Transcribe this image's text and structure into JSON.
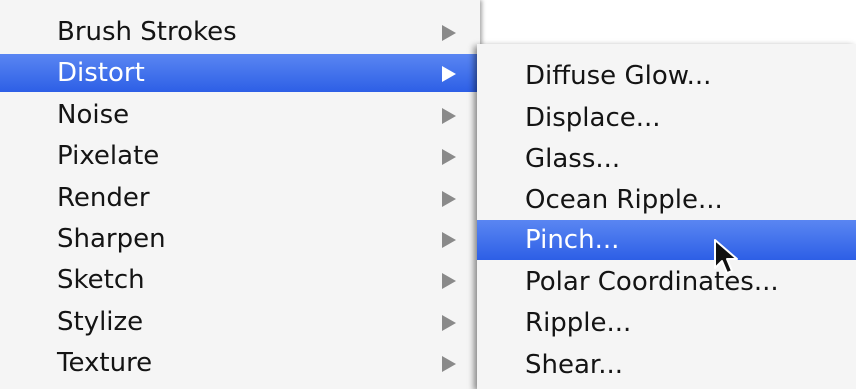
{
  "menu": {
    "items": [
      {
        "label": "Brush Strokes"
      },
      {
        "label": "Distort"
      },
      {
        "label": "Noise"
      },
      {
        "label": "Pixelate"
      },
      {
        "label": "Render"
      },
      {
        "label": "Sharpen"
      },
      {
        "label": "Sketch"
      },
      {
        "label": "Stylize"
      },
      {
        "label": "Texture"
      }
    ],
    "selected": "Distort"
  },
  "submenu": {
    "items": [
      {
        "label": "Diffuse Glow..."
      },
      {
        "label": "Displace..."
      },
      {
        "label": "Glass..."
      },
      {
        "label": "Ocean Ripple..."
      },
      {
        "label": "Pinch..."
      },
      {
        "label": "Polar Coordinates..."
      },
      {
        "label": "Ripple..."
      },
      {
        "label": "Shear..."
      }
    ],
    "selected": "Pinch..."
  },
  "icons": {
    "submenu_arrow": "chevron-right-icon",
    "cursor": "arrow-cursor-icon"
  },
  "colors": {
    "highlight": "#2d5fe6",
    "menu_background": "#f5f5f5",
    "text": "#141414",
    "arrow": "#8a8a8a"
  }
}
